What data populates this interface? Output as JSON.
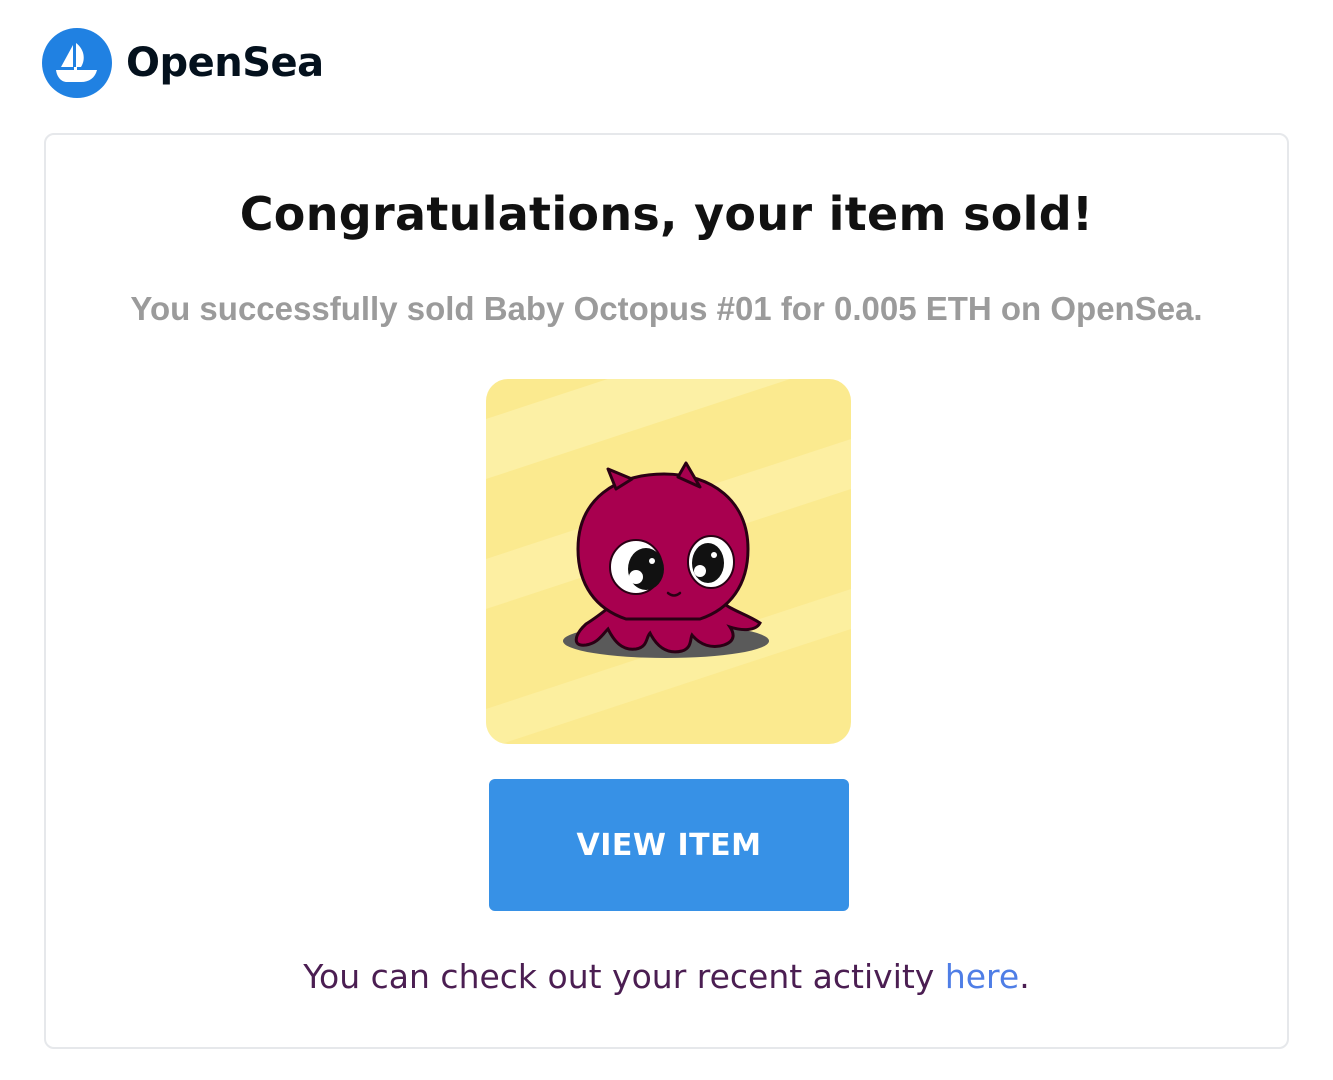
{
  "brand": {
    "name": "OpenSea",
    "logo_icon": "opensea-boat-icon",
    "logo_color": "#2081e2"
  },
  "email": {
    "headline": "Congratulations, your item sold!",
    "message": "You successfully sold Baby Octopus #01 for 0.005 ETH on OpenSea.",
    "item_image": {
      "icon": "baby-octopus-icon",
      "background_color": "#fbea8f",
      "octopus_color": "#a8004f"
    },
    "button": {
      "label": "VIEW ITEM",
      "color": "#3791e6"
    },
    "footer": {
      "text": "You can check out your recent activity ",
      "link_label": "here",
      "trailing": "."
    }
  }
}
